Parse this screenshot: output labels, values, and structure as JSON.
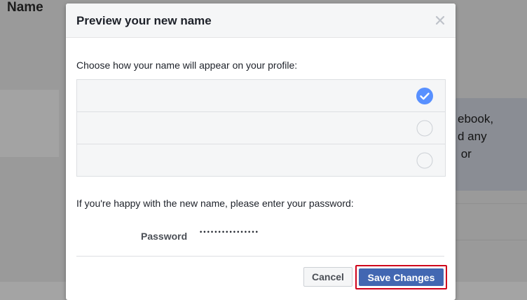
{
  "background": {
    "section_title": "Name",
    "info_text": "ebook,\nd any\n or"
  },
  "dialog": {
    "title": "Preview your new name",
    "close_icon": "close-icon",
    "prompt": "Choose how your name will appear on your profile:",
    "options": [
      {
        "label": "",
        "selected": true
      },
      {
        "label": "",
        "selected": false
      },
      {
        "label": "",
        "selected": false
      }
    ],
    "password_prompt": "If you're happy with the new name, please enter your password:",
    "password_label": "Password",
    "password_value": "••••••••••••••••",
    "cancel_label": "Cancel",
    "save_label": "Save Changes"
  },
  "colors": {
    "accent": "#4267b2",
    "check": "#5890ff",
    "highlight": "#d0021b"
  }
}
